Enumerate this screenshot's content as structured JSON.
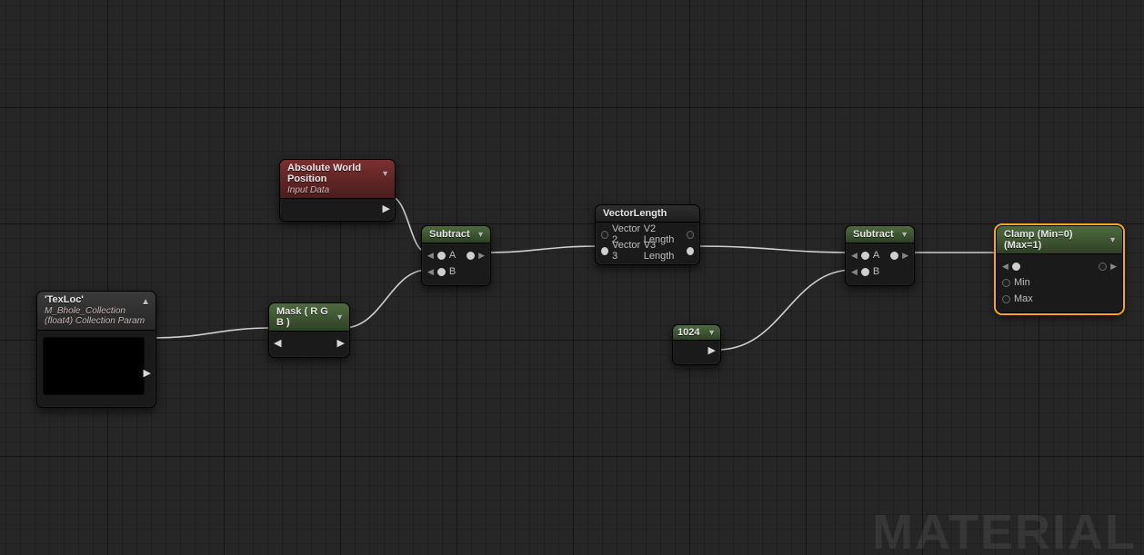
{
  "watermark": "MATERIAL",
  "nodes": {
    "texloc": {
      "title": "'TexLoc'",
      "subtitle": "M_Bhole_Collection (float4) Collection Param"
    },
    "awp": {
      "title": "Absolute World Position",
      "subtitle": "Input Data"
    },
    "mask": {
      "title": "Mask ( R G B )"
    },
    "subtract1": {
      "title": "Subtract",
      "inA": "A",
      "inB": "B"
    },
    "vectorlen": {
      "title": "VectorLength",
      "row1_left": "Vector 2",
      "row1_right": "V2 Length",
      "row2_left": "Vector 3",
      "row2_right": "V3 Length"
    },
    "const1024": {
      "title": "1024"
    },
    "subtract2": {
      "title": "Subtract",
      "inA": "A",
      "inB": "B"
    },
    "clamp": {
      "title": "Clamp (Min=0) (Max=1)",
      "inMin": "Min",
      "inMax": "Max"
    }
  }
}
